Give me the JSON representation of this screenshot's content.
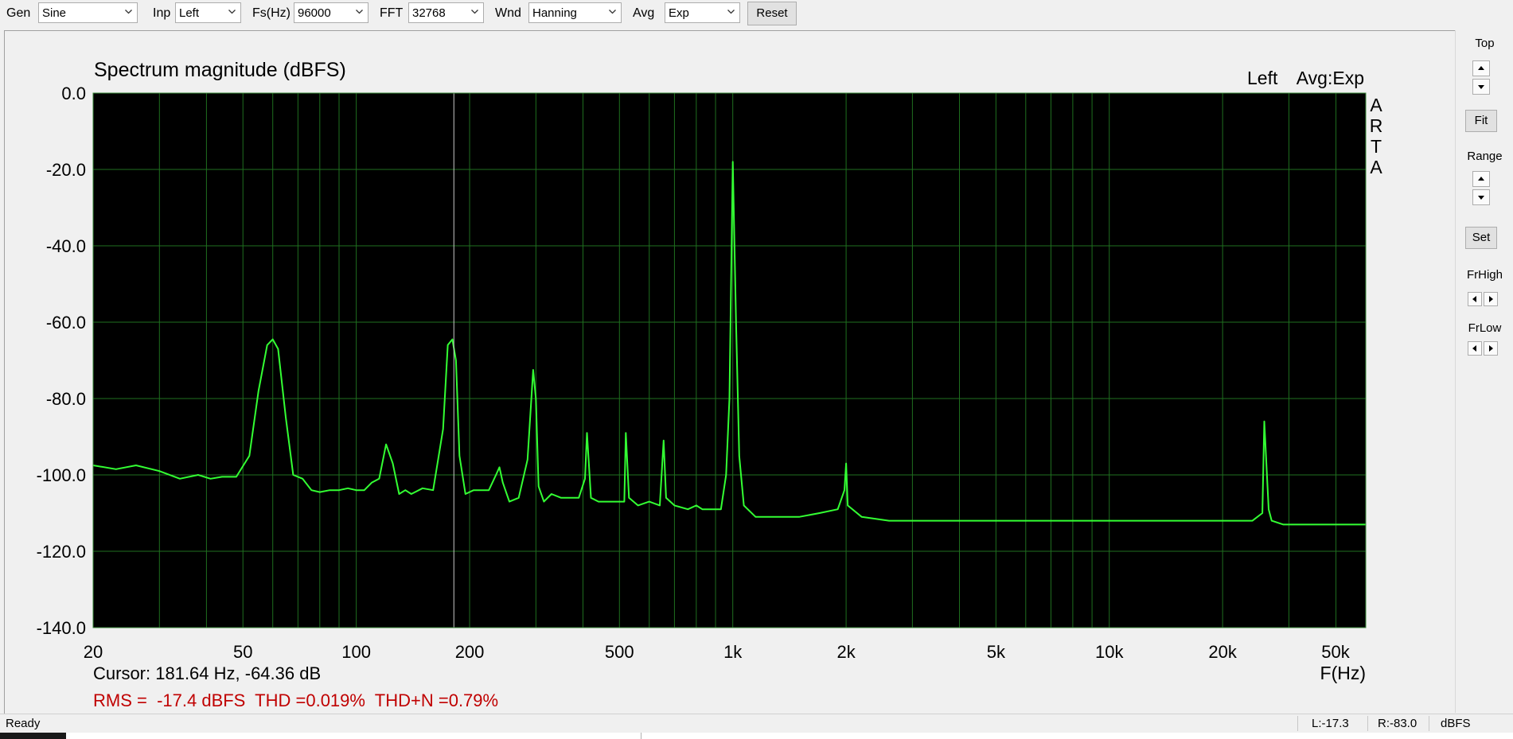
{
  "toolbar": {
    "gen": {
      "label": "Gen",
      "value": "Sine"
    },
    "inp": {
      "label": "Inp",
      "value": "Left"
    },
    "fs": {
      "label": "Fs(Hz)",
      "value": "96000"
    },
    "fft": {
      "label": "FFT",
      "value": "32768"
    },
    "wnd": {
      "label": "Wnd",
      "value": "Hanning"
    },
    "avg": {
      "label": "Avg",
      "value": "Exp"
    },
    "reset_label": "Reset"
  },
  "plot": {
    "title": "Spectrum magnitude (dBFS)",
    "channel": "Left",
    "avg_mode": "Avg:Exp",
    "brand": [
      "A",
      "R",
      "T",
      "A"
    ],
    "xlabel": "F(Hz)",
    "cursor_text": "Cursor: 181.64 Hz, -64.36 dB",
    "stats_text": "RMS =  -17.4 dBFS  THD =0.019%  THD+N =0.79%",
    "colors": {
      "background": "#000000",
      "grid": "#1f6f1f",
      "trace": "#33ff33",
      "cursor": "#c8c8c8",
      "stats": "#c00000"
    }
  },
  "side": {
    "top_label": "Top",
    "fit_label": "Fit",
    "range_label": "Range",
    "set_label": "Set",
    "frhigh_label": "FrHigh",
    "frlow_label": "FrLow"
  },
  "status": {
    "ready": "Ready",
    "left_level": "L:-17.3",
    "right_level": "R:-83.0",
    "units": "dBFS"
  },
  "chart_data": {
    "type": "line",
    "title": "Spectrum magnitude (dBFS)",
    "xlabel": "F(Hz)",
    "ylabel": "",
    "x_scale": "log",
    "xlim": [
      20,
      48000
    ],
    "ylim": [
      -140,
      0
    ],
    "grid": true,
    "legend": "none",
    "x_ticks": [
      20,
      50,
      100,
      200,
      500,
      1000,
      2000,
      5000,
      10000,
      20000,
      50000
    ],
    "x_tick_labels": [
      "20",
      "50",
      "100",
      "200",
      "500",
      "1k",
      "2k",
      "5k",
      "10k",
      "20k",
      "50k"
    ],
    "y_ticks": [
      0,
      -20,
      -40,
      -60,
      -80,
      -100,
      -120,
      -140
    ],
    "y_tick_labels": [
      "0.0",
      "-20.0",
      "-40.0",
      "-60.0",
      "-80.0",
      "-100.0",
      "-120.0",
      "-140.0"
    ],
    "cursor_hz": 181.64,
    "cursor_db": -64.36,
    "series": [
      {
        "x": [
          20,
          23,
          26,
          30,
          34,
          38,
          41,
          44,
          48,
          52,
          55,
          58,
          60,
          62,
          65,
          68,
          72,
          76,
          80,
          85,
          90,
          95,
          100,
          105,
          110,
          115,
          120,
          125,
          130,
          135,
          140,
          150,
          160,
          170,
          175,
          180,
          184,
          188,
          195,
          205,
          215,
          225,
          235,
          240,
          245,
          255,
          270,
          285,
          295,
          300,
          305,
          315,
          330,
          350,
          370,
          390,
          405,
          410,
          420,
          440,
          460,
          490,
          515,
          520,
          530,
          560,
          600,
          640,
          655,
          665,
          700,
          760,
          800,
          830,
          880,
          930,
          960,
          980,
          1000,
          1020,
          1040,
          1070,
          1150,
          1300,
          1500,
          1700,
          1900,
          1980,
          2000,
          2020,
          2200,
          2600,
          3000,
          3600,
          4200,
          5000,
          6000,
          7000,
          8000,
          9000,
          10000,
          12000,
          14000,
          16000,
          18000,
          20000,
          22000,
          24000,
          25500,
          25800,
          26500,
          27000,
          29000,
          32000,
          36000,
          40000,
          44000,
          48000
        ],
        "y": [
          -97.5,
          -98.5,
          -97.5,
          -99,
          -101,
          -100,
          -101,
          -100.5,
          -100.5,
          -95,
          -78,
          -66,
          -64.5,
          -67,
          -85,
          -100,
          -101,
          -104,
          -104.5,
          -104,
          -104,
          -103.5,
          -104,
          -104,
          -102,
          -101,
          -92,
          -97,
          -105,
          -104,
          -105,
          -103.5,
          -104,
          -88,
          -66,
          -64.5,
          -70,
          -95,
          -105,
          -104,
          -104,
          -104,
          -100,
          -98,
          -102,
          -107,
          -106,
          -96,
          -72.5,
          -80,
          -103,
          -107,
          -105,
          -106,
          -106,
          -106,
          -101,
          -89,
          -106,
          -107,
          -107,
          -107,
          -107,
          -89,
          -106,
          -108,
          -107,
          -108,
          -91,
          -106,
          -108,
          -109,
          -108,
          -109,
          -109,
          -109,
          -100,
          -80,
          -18,
          -60,
          -95,
          -108,
          -111,
          -111,
          -111,
          -110,
          -109,
          -104,
          -97,
          -108,
          -111,
          -112,
          -112,
          -112,
          -112,
          -112,
          -112,
          -112,
          -112,
          -112,
          -112,
          -112,
          -112,
          -112,
          -112,
          -112,
          -112,
          -112,
          -110,
          -86,
          -109,
          -112,
          -113,
          -113,
          -113,
          -113,
          -113,
          -113
        ]
      }
    ]
  }
}
